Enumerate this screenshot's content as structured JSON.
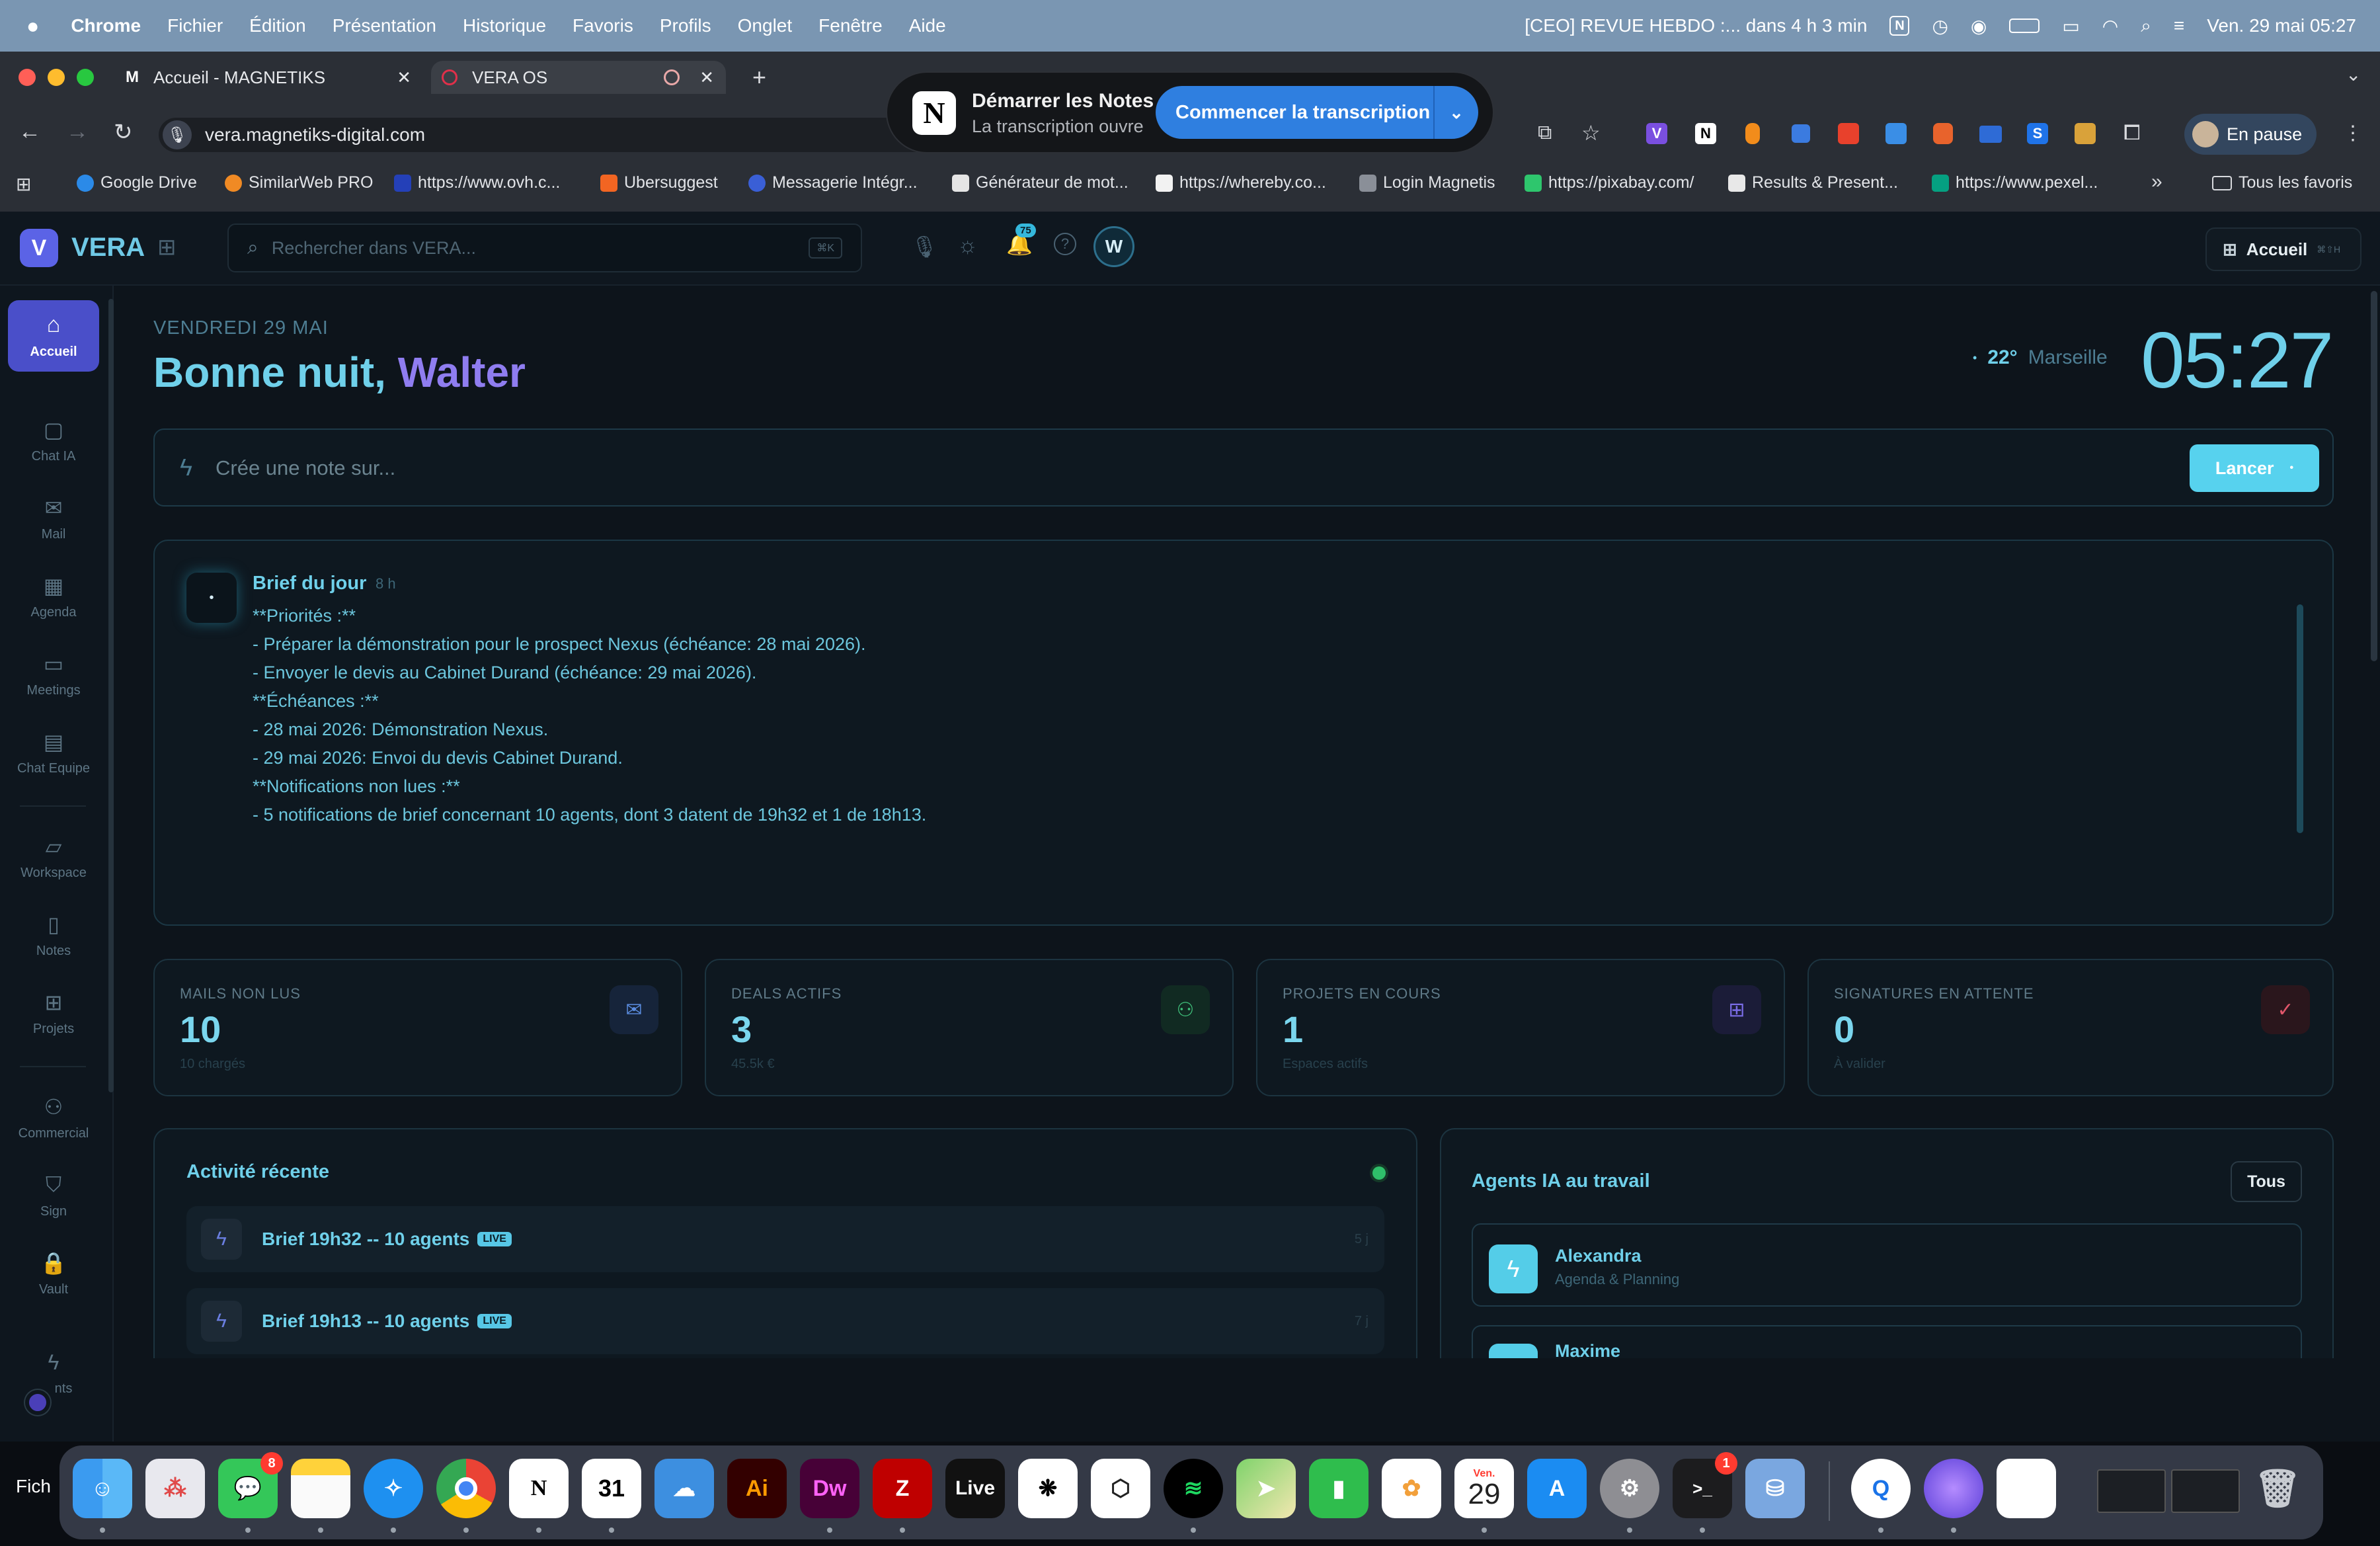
{
  "menubar": {
    "app": "Chrome",
    "items": [
      "Fichier",
      "Édition",
      "Présentation",
      "Historique",
      "Favoris",
      "Profils",
      "Onglet",
      "Fenêtre",
      "Aide"
    ],
    "event": "[CEO] REVUE HEBDO :... dans 4 h 3 min",
    "datetime": "Ven. 29 mai  05:27"
  },
  "browser": {
    "tabs": [
      {
        "title": "Accueil - MAGNETIKS"
      },
      {
        "title": "VERA OS"
      }
    ],
    "url": "vera.magnetiks-digital.com",
    "profile_label": "En pause",
    "bookmarks": [
      "Google Drive",
      "SimilarWeb PRO",
      "https://www.ovh.c...",
      "Ubersuggest",
      "Messagerie Intégr...",
      "Générateur de mot...",
      "https://whereby.co...",
      "Login Magnetis",
      "https://pixabay.com/",
      "Results & Present...",
      "https://www.pexel..."
    ],
    "all_bookmarks": "Tous les favoris"
  },
  "notion_popup": {
    "title": "Démarrer les Notes",
    "subtitle": "La transcription ouvre",
    "button": "Commencer la transcription"
  },
  "app": {
    "brand": "VERA",
    "search_placeholder": "Rechercher dans VERA...",
    "search_shortcut": "⌘K",
    "notif_count": "75",
    "avatar": "W",
    "home_button": "Accueil",
    "home_shortcut": "⌘⇧H"
  },
  "sidebar": {
    "items": [
      {
        "label": "Accueil",
        "icon": "home-icon"
      },
      {
        "label": "Chat IA",
        "icon": "chat-icon"
      },
      {
        "label": "Mail",
        "icon": "mail-icon"
      },
      {
        "label": "Agenda",
        "icon": "calendar-icon"
      },
      {
        "label": "Meetings",
        "icon": "video-icon"
      },
      {
        "label": "Chat Equipe",
        "icon": "team-chat-icon"
      },
      {
        "label": "Workspace",
        "icon": "folder-icon"
      },
      {
        "label": "Notes",
        "icon": "note-icon"
      },
      {
        "label": "Projets",
        "icon": "grid-icon"
      },
      {
        "label": "Commercial",
        "icon": "users-icon"
      },
      {
        "label": "Sign",
        "icon": "shield-icon"
      },
      {
        "label": "Vault",
        "icon": "lock-icon"
      },
      {
        "label": "nts",
        "icon": "bolt-icon"
      }
    ]
  },
  "header": {
    "date": "VENDREDI 29 MAI",
    "greeting": "Bonne nuit,",
    "name": "Walter",
    "weather_temp": "22°",
    "weather_city": "Marseille",
    "clock": "05:27"
  },
  "note_input": {
    "placeholder": "Crée une note sur...",
    "button": "Lancer"
  },
  "brief": {
    "title": "Brief du jour",
    "age": "8 h",
    "lines": [
      "**Priorités :**",
      "- Préparer la démonstration pour le prospect Nexus (échéance: 28 mai 2026).",
      "- Envoyer le devis au Cabinet Durand (échéance: 29 mai 2026).",
      "",
      "**Échéances :**",
      "- 28 mai 2026: Démonstration Nexus.",
      "- 29 mai 2026: Envoi du devis Cabinet Durand.",
      "",
      "**Notifications non lues :**",
      "- 5 notifications de brief concernant 10 agents, dont 3 datent de 19h32 et 1 de 18h13."
    ]
  },
  "stats": [
    {
      "label": "MAILS NON LUS",
      "value": "10",
      "sub": "10 chargés",
      "icon": "mail-icon",
      "color": "#5b8de0"
    },
    {
      "label": "DEALS ACTIFS",
      "value": "3",
      "sub": "45.5k €",
      "icon": "users-icon",
      "color": "#3fbf7a"
    },
    {
      "label": "PROJETS EN COURS",
      "value": "1",
      "sub": "Espaces actifs",
      "icon": "grid-icon",
      "color": "#7a6ce6"
    },
    {
      "label": "SIGNATURES EN ATTENTE",
      "value": "0",
      "sub": "À valider",
      "icon": "check-icon",
      "color": "#e0566a"
    }
  ],
  "activity": {
    "title": "Activité récente",
    "rows": [
      {
        "title": "Brief 19h32 -- 10 agents",
        "badge": "LIVE",
        "age": "5 j"
      },
      {
        "title": "Brief 19h13 -- 10 agents",
        "badge": "LIVE",
        "age": "7 j"
      }
    ]
  },
  "agents": {
    "title": "Agents IA au travail",
    "all_button": "Tous",
    "items": [
      {
        "name": "Alexandra",
        "role": "Agenda & Planning"
      },
      {
        "name": "Maxime",
        "role": ""
      }
    ]
  },
  "dock": {
    "finder_label": "Fich",
    "messages_badge": "8",
    "terminal_badge": "1",
    "calendar_month": "Ven.",
    "calendar_day": "29",
    "apps": [
      "finder-icon",
      "launchpad-icon",
      "messages-icon",
      "notes-icon",
      "safari-icon",
      "chrome-icon",
      "notion-icon",
      "notion-calendar-icon",
      "weather-icon",
      "illustrator-icon",
      "dreamweaver-icon",
      "filezilla-icon",
      "live-icon",
      "chatgpt-icon",
      "box-icon",
      "spotify-icon",
      "maps-icon",
      "numbers-icon",
      "photos-icon",
      "calendar-icon",
      "appstore-icon",
      "settings-icon",
      "terminal-icon",
      "backup-icon",
      "quicktime-icon",
      "siri-icon",
      "doc-icon",
      "window-thumb-icon",
      "window-thumb-icon",
      "trash-icon"
    ],
    "illustrator_text": "Ai",
    "dreamweaver_text": "Dw",
    "live_text": "Live"
  }
}
